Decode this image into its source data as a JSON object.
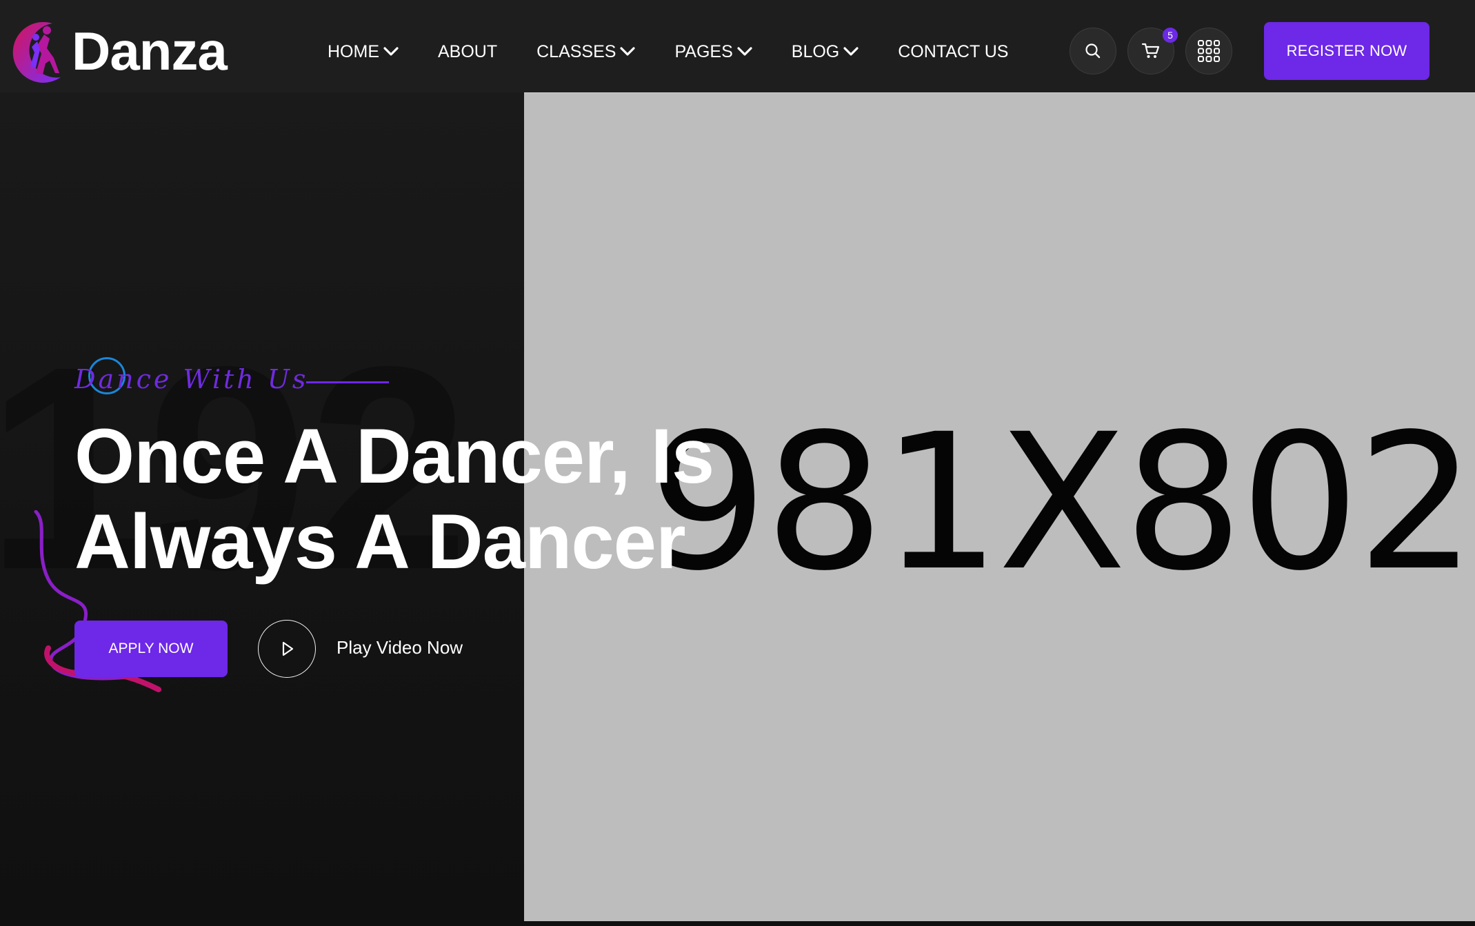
{
  "brand": {
    "name": "Danza"
  },
  "nav": {
    "items": [
      {
        "label": "HOME",
        "has_dropdown": true
      },
      {
        "label": "ABOUT",
        "has_dropdown": false
      },
      {
        "label": "CLASSES",
        "has_dropdown": true
      },
      {
        "label": "PAGES",
        "has_dropdown": true
      },
      {
        "label": "BLOG",
        "has_dropdown": true
      },
      {
        "label": "CONTACT US",
        "has_dropdown": false
      }
    ]
  },
  "header_actions": {
    "search_icon": "search-icon",
    "cart_icon": "cart-icon",
    "cart_count": "5",
    "grid_icon": "grid-menu-icon",
    "register_label": "REGISTER NOW"
  },
  "hero": {
    "ghost_text": "192",
    "tagline": "Dance With Us",
    "headline_line1": "Once A Dancer, Is",
    "headline_line2": "Always A Dancer",
    "apply_label": "APPLY NOW",
    "play_label": "Play Video Now",
    "image_placeholder": "981X802"
  },
  "colors": {
    "accent": "#6d28e8",
    "header_bg": "#1e1e1e",
    "page_bg": "#161616",
    "placeholder_bg": "#bdbdbd",
    "ring": "#1b86d9",
    "ribbon": "#c1126b"
  }
}
